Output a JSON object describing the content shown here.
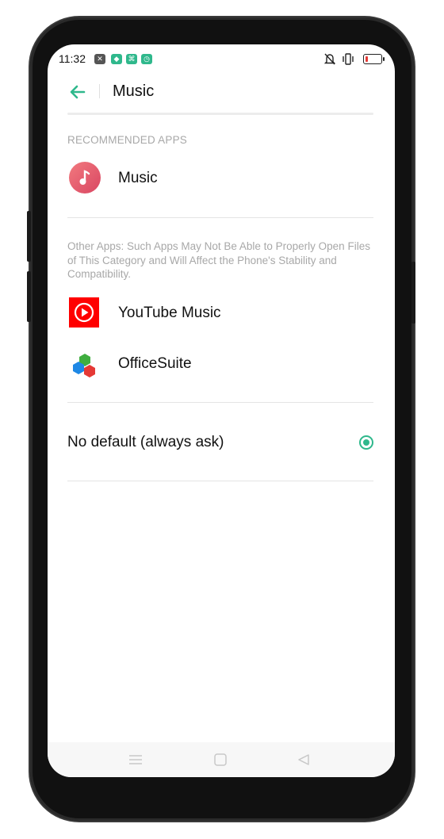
{
  "status_bar": {
    "time": "11:32",
    "left_icons": [
      "notification-x-icon",
      "shield-icon",
      "app-icon",
      "clock-icon"
    ],
    "right_icons": [
      "mute-icon",
      "vibrate-icon",
      "battery-icon"
    ],
    "battery_level_percent": 10
  },
  "header": {
    "title": "Music",
    "back_icon": "arrow-left-icon"
  },
  "recommended": {
    "label": "RECOMMENDED APPS",
    "apps": [
      {
        "name": "Music",
        "icon": "music-note-icon"
      }
    ]
  },
  "other": {
    "note": "Other Apps: Such Apps May Not Be Able to Properly Open Files of This Category and Will Affect the Phone's Stability and Compatibility.",
    "apps": [
      {
        "name": "YouTube Music",
        "icon": "youtube-music-icon"
      },
      {
        "name": "OfficeSuite",
        "icon": "officesuite-icon"
      }
    ]
  },
  "default_option": {
    "label": "No default (always ask)",
    "selected": true
  },
  "navbar": {
    "buttons": [
      "menu-icon",
      "home-icon",
      "back-triangle-icon"
    ]
  },
  "colors": {
    "accent": "#2fb88c",
    "music_icon": "#e45b6a",
    "youtube_red": "#ff0000"
  }
}
